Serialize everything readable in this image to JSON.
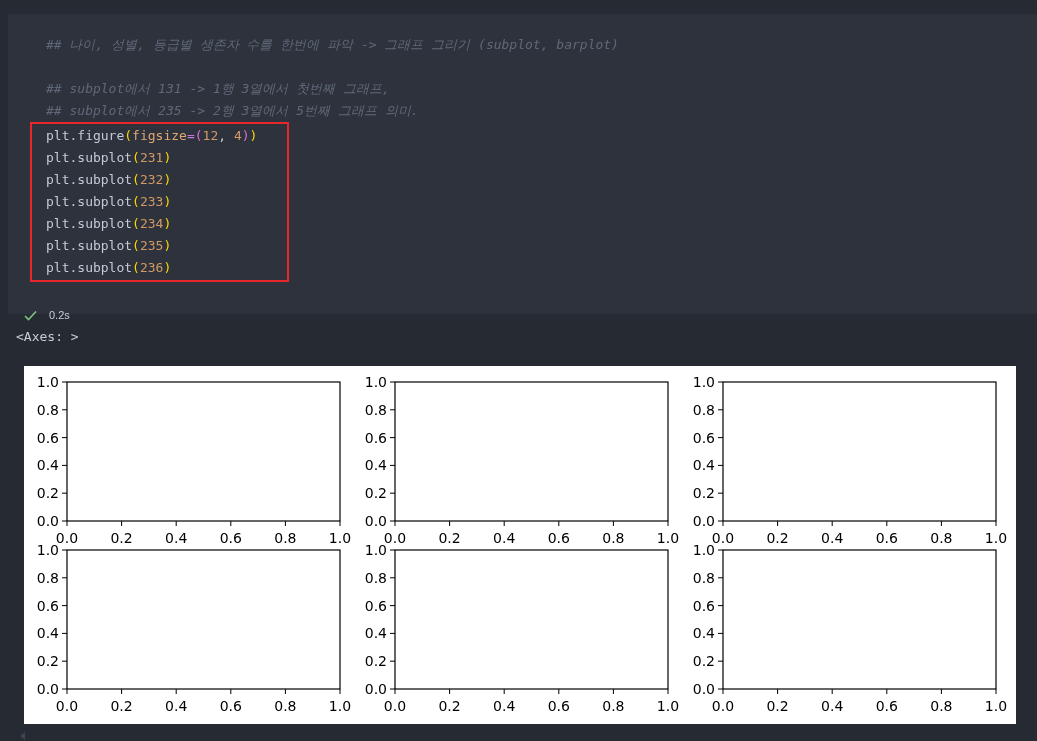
{
  "cell": {
    "sections": [
      {
        "lines": [
          {
            "kind": "comment",
            "text": "## 나이, 성별, 등급별 생존자 수를 한번에 파악 -> 그래프 그리기 (subplot, barplot)"
          }
        ]
      },
      {
        "lines": [
          {
            "kind": "comment",
            "text": "## subplot에서 131 -> 1행 3열에서 첫번째 그래프,"
          },
          {
            "kind": "comment",
            "text": "## subplot에서 235 -> 2행 3열에서 5번째 그래프 의미."
          },
          {
            "kind": "code",
            "highlighted": true,
            "tokens": [
              {
                "kind": "ident",
                "text": "plt.figure"
              },
              {
                "kind": "paren1",
                "text": "("
              },
              {
                "kind": "param",
                "text": "figsize"
              },
              {
                "kind": "op",
                "text": "="
              },
              {
                "kind": "paren2",
                "text": "("
              },
              {
                "kind": "number",
                "text": "12"
              },
              {
                "kind": "ident",
                "text": ", "
              },
              {
                "kind": "number",
                "text": "4"
              },
              {
                "kind": "paren2",
                "text": ")"
              },
              {
                "kind": "paren1",
                "text": ")"
              }
            ]
          },
          {
            "kind": "code",
            "highlighted": true,
            "tokens": [
              {
                "kind": "ident",
                "text": "plt.subplot"
              },
              {
                "kind": "paren1",
                "text": "("
              },
              {
                "kind": "number",
                "text": "231"
              },
              {
                "kind": "paren1",
                "text": ")"
              }
            ]
          },
          {
            "kind": "code",
            "highlighted": true,
            "tokens": [
              {
                "kind": "ident",
                "text": "plt.subplot"
              },
              {
                "kind": "paren1",
                "text": "("
              },
              {
                "kind": "number",
                "text": "232"
              },
              {
                "kind": "paren1",
                "text": ")"
              }
            ]
          },
          {
            "kind": "code",
            "highlighted": true,
            "tokens": [
              {
                "kind": "ident",
                "text": "plt.subplot"
              },
              {
                "kind": "paren1",
                "text": "("
              },
              {
                "kind": "number",
                "text": "233"
              },
              {
                "kind": "paren1",
                "text": ")"
              }
            ]
          },
          {
            "kind": "code",
            "highlighted": true,
            "tokens": [
              {
                "kind": "ident",
                "text": "plt.subplot"
              },
              {
                "kind": "paren1",
                "text": "("
              },
              {
                "kind": "number",
                "text": "234"
              },
              {
                "kind": "paren1",
                "text": ")"
              }
            ]
          },
          {
            "kind": "code",
            "highlighted": true,
            "tokens": [
              {
                "kind": "ident",
                "text": "plt.subplot"
              },
              {
                "kind": "paren1",
                "text": "("
              },
              {
                "kind": "number",
                "text": "235"
              },
              {
                "kind": "paren1",
                "text": ")"
              }
            ]
          },
          {
            "kind": "code",
            "highlighted": true,
            "tokens": [
              {
                "kind": "ident",
                "text": "plt.subplot"
              },
              {
                "kind": "paren1",
                "text": "("
              },
              {
                "kind": "number",
                "text": "236"
              },
              {
                "kind": "paren1",
                "text": ")"
              }
            ]
          }
        ]
      }
    ],
    "status": {
      "success": true,
      "duration": "0.2s"
    }
  },
  "output": {
    "text": "<Axes: >",
    "figure": {
      "axes": [
        {
          "chart_data": {
            "type": "line",
            "xlim": [
              0,
              1
            ],
            "ylim": [
              0,
              1
            ],
            "xticks": [
              {
                "value": 0,
                "label": "0.0"
              },
              {
                "value": 0.2,
                "label": "0.2"
              },
              {
                "value": 0.4,
                "label": "0.4"
              },
              {
                "value": 0.6,
                "label": "0.6"
              },
              {
                "value": 0.8,
                "label": "0.8"
              },
              {
                "value": 1,
                "label": "1.0"
              }
            ],
            "yticks": [
              {
                "value": 0,
                "label": "0.0"
              },
              {
                "value": 0.2,
                "label": "0.2"
              },
              {
                "value": 0.4,
                "label": "0.4"
              },
              {
                "value": 0.6,
                "label": "0.6"
              },
              {
                "value": 0.8,
                "label": "0.8"
              },
              {
                "value": 1,
                "label": "1.0"
              }
            ]
          }
        },
        {
          "chart_data": {
            "type": "line",
            "xlim": [
              0,
              1
            ],
            "ylim": [
              0,
              1
            ],
            "xticks": [
              {
                "value": 0,
                "label": "0.0"
              },
              {
                "value": 0.2,
                "label": "0.2"
              },
              {
                "value": 0.4,
                "label": "0.4"
              },
              {
                "value": 0.6,
                "label": "0.6"
              },
              {
                "value": 0.8,
                "label": "0.8"
              },
              {
                "value": 1,
                "label": "1.0"
              }
            ],
            "yticks": [
              {
                "value": 0,
                "label": "0.0"
              },
              {
                "value": 0.2,
                "label": "0.2"
              },
              {
                "value": 0.4,
                "label": "0.4"
              },
              {
                "value": 0.6,
                "label": "0.6"
              },
              {
                "value": 0.8,
                "label": "0.8"
              },
              {
                "value": 1,
                "label": "1.0"
              }
            ]
          }
        },
        {
          "chart_data": {
            "type": "line",
            "xlim": [
              0,
              1
            ],
            "ylim": [
              0,
              1
            ],
            "xticks": [
              {
                "value": 0,
                "label": "0.0"
              },
              {
                "value": 0.2,
                "label": "0.2"
              },
              {
                "value": 0.4,
                "label": "0.4"
              },
              {
                "value": 0.6,
                "label": "0.6"
              },
              {
                "value": 0.8,
                "label": "0.8"
              },
              {
                "value": 1,
                "label": "1.0"
              }
            ],
            "yticks": [
              {
                "value": 0,
                "label": "0.0"
              },
              {
                "value": 0.2,
                "label": "0.2"
              },
              {
                "value": 0.4,
                "label": "0.4"
              },
              {
                "value": 0.6,
                "label": "0.6"
              },
              {
                "value": 0.8,
                "label": "0.8"
              },
              {
                "value": 1,
                "label": "1.0"
              }
            ]
          }
        },
        {
          "chart_data": {
            "type": "line",
            "xlim": [
              0,
              1
            ],
            "ylim": [
              0,
              1
            ],
            "xticks": [
              {
                "value": 0,
                "label": "0.0"
              },
              {
                "value": 0.2,
                "label": "0.2"
              },
              {
                "value": 0.4,
                "label": "0.4"
              },
              {
                "value": 0.6,
                "label": "0.6"
              },
              {
                "value": 0.8,
                "label": "0.8"
              },
              {
                "value": 1,
                "label": "1.0"
              }
            ],
            "yticks": [
              {
                "value": 0,
                "label": "0.0"
              },
              {
                "value": 0.2,
                "label": "0.2"
              },
              {
                "value": 0.4,
                "label": "0.4"
              },
              {
                "value": 0.6,
                "label": "0.6"
              },
              {
                "value": 0.8,
                "label": "0.8"
              },
              {
                "value": 1,
                "label": "1.0"
              }
            ]
          }
        },
        {
          "chart_data": {
            "type": "line",
            "xlim": [
              0,
              1
            ],
            "ylim": [
              0,
              1
            ],
            "xticks": [
              {
                "value": 0,
                "label": "0.0"
              },
              {
                "value": 0.2,
                "label": "0.2"
              },
              {
                "value": 0.4,
                "label": "0.4"
              },
              {
                "value": 0.6,
                "label": "0.6"
              },
              {
                "value": 0.8,
                "label": "0.8"
              },
              {
                "value": 1,
                "label": "1.0"
              }
            ],
            "yticks": [
              {
                "value": 0,
                "label": "0.0"
              },
              {
                "value": 0.2,
                "label": "0.2"
              },
              {
                "value": 0.4,
                "label": "0.4"
              },
              {
                "value": 0.6,
                "label": "0.6"
              },
              {
                "value": 0.8,
                "label": "0.8"
              },
              {
                "value": 1,
                "label": "1.0"
              }
            ]
          }
        },
        {
          "chart_data": {
            "type": "line",
            "xlim": [
              0,
              1
            ],
            "ylim": [
              0,
              1
            ],
            "xticks": [
              {
                "value": 0,
                "label": "0.0"
              },
              {
                "value": 0.2,
                "label": "0.2"
              },
              {
                "value": 0.4,
                "label": "0.4"
              },
              {
                "value": 0.6,
                "label": "0.6"
              },
              {
                "value": 0.8,
                "label": "0.8"
              },
              {
                "value": 1,
                "label": "1.0"
              }
            ],
            "yticks": [
              {
                "value": 0,
                "label": "0.0"
              },
              {
                "value": 0.2,
                "label": "0.2"
              },
              {
                "value": 0.4,
                "label": "0.4"
              },
              {
                "value": 0.6,
                "label": "0.6"
              },
              {
                "value": 0.8,
                "label": "0.8"
              },
              {
                "value": 1,
                "label": "1.0"
              }
            ]
          }
        }
      ]
    }
  }
}
